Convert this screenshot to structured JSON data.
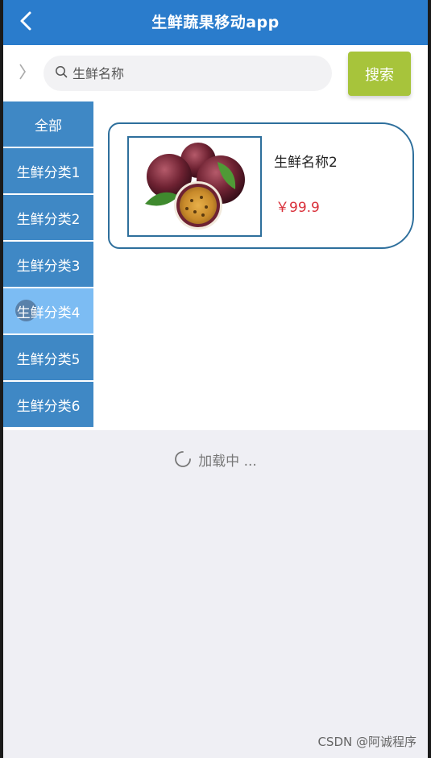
{
  "header": {
    "title": "生鲜蔬果移动app",
    "back_icon": "chevron-left-icon"
  },
  "search": {
    "placeholder": "生鲜名称",
    "button_label": "搜索",
    "toggle_icon": "chevron-right-icon",
    "search_icon": "search-icon"
  },
  "categories": [
    {
      "label": "全部",
      "active": false
    },
    {
      "label": "生鲜分类1",
      "active": false
    },
    {
      "label": "生鲜分类2",
      "active": false
    },
    {
      "label": "生鲜分类3",
      "active": false
    },
    {
      "label": "生鲜分类4",
      "active": true
    },
    {
      "label": "生鲜分类5",
      "active": false
    },
    {
      "label": "生鲜分类6",
      "active": false
    }
  ],
  "products": [
    {
      "name": "生鲜名称2",
      "price": "￥99.9"
    }
  ],
  "loading_text": "加载中 ...",
  "watermark": "CSDN @阿诚程序",
  "colors": {
    "header_bg": "#2a7ccc",
    "category_bg": "#3f88c5",
    "category_active_bg": "#7cbcf3",
    "search_button_bg": "#a7c43b",
    "price": "#d9303a",
    "card_border": "#2e6f9c"
  }
}
